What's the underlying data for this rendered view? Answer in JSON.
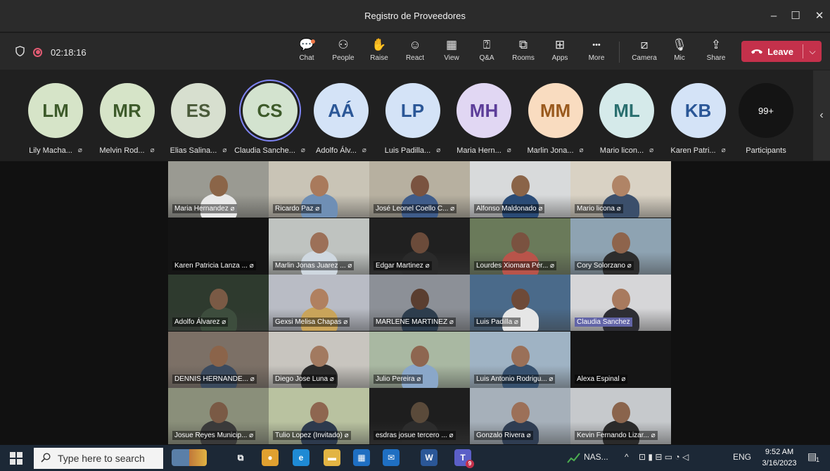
{
  "window": {
    "title": "Registro de Proveedores",
    "controls": [
      "–",
      "☐",
      "✕"
    ]
  },
  "meeting": {
    "timer": "02:18:16",
    "toolbar": [
      {
        "key": "chat",
        "label": "Chat",
        "icon": "chat-icon"
      },
      {
        "key": "people",
        "label": "People",
        "icon": "people-icon"
      },
      {
        "key": "raise",
        "label": "Raise",
        "icon": "raise-hand-icon"
      },
      {
        "key": "react",
        "label": "React",
        "icon": "smile-icon"
      },
      {
        "key": "view",
        "label": "View",
        "icon": "grid-icon"
      },
      {
        "key": "qa",
        "label": "Q&A",
        "icon": "qa-icon"
      },
      {
        "key": "rooms",
        "label": "Rooms",
        "icon": "rooms-icon"
      },
      {
        "key": "apps",
        "label": "Apps",
        "icon": "plus-square-icon"
      },
      {
        "key": "more",
        "label": "More",
        "icon": "ellipsis-icon"
      },
      {
        "key": "camera",
        "label": "Camera",
        "icon": "camera-off-icon"
      },
      {
        "key": "mic",
        "label": "Mic",
        "icon": "mic-off-icon"
      },
      {
        "key": "share",
        "label": "Share",
        "icon": "share-icon"
      }
    ],
    "leave_label": "Leave",
    "colors": {
      "leave": "#c4314b",
      "accent": "#6264a7",
      "recording": "#e25b73"
    }
  },
  "strip": {
    "participants": [
      {
        "initials": "LM",
        "name": "Lily Macha...",
        "bg": "#d6e4c8",
        "fg": "#3d5a2a"
      },
      {
        "initials": "MR",
        "name": "Melvin Rod...",
        "bg": "#d6e4c8",
        "fg": "#3d5a2a"
      },
      {
        "initials": "ES",
        "name": "Elias Salina...",
        "bg": "#d7dfcf",
        "fg": "#4a5a3a"
      },
      {
        "initials": "CS",
        "name": "Claudia Sanche...",
        "bg": "#d3e3cf",
        "fg": "#3d5a2a",
        "speaking": true
      },
      {
        "initials": "AÁ",
        "name": "Adolfo Álv...",
        "bg": "#d4e3f7",
        "fg": "#2b5797"
      },
      {
        "initials": "LP",
        "name": "Luis Padilla...",
        "bg": "#d4e3f7",
        "fg": "#2b5797"
      },
      {
        "initials": "MH",
        "name": "Maria Hern...",
        "bg": "#e1d7f3",
        "fg": "#5c3d99"
      },
      {
        "initials": "MM",
        "name": "Marlin Jona...",
        "bg": "#f9dcc0",
        "fg": "#9a5a1e"
      },
      {
        "initials": "ML",
        "name": "Mario licon...",
        "bg": "#d5eaea",
        "fg": "#2a6f6f"
      },
      {
        "initials": "KB",
        "name": "Karen Patri...",
        "bg": "#d4e3f7",
        "fg": "#2b5797"
      }
    ],
    "more_count": "99+",
    "more_label": "Participants"
  },
  "gallery": {
    "tiles": [
      {
        "name": "Maria Hernandez",
        "col": 0,
        "row": 0,
        "scene": "#9a9a92",
        "shirt": "#e9e9e9",
        "skin": "#8b6548"
      },
      {
        "name": "Ricardo Paz",
        "col": 1,
        "row": 0,
        "scene": "#c9c4b6",
        "shirt": "#6f8fb5",
        "skin": "#a97a5c"
      },
      {
        "name": "José Leonel Coello C...",
        "col": 2,
        "row": 0,
        "scene": "#b7b0a0",
        "shirt": "#3f5c8a",
        "skin": "#7a5340"
      },
      {
        "name": "Alfonso Maldonado",
        "col": 3,
        "row": 0,
        "scene": "#d8dadb",
        "shirt": "#2a4b76",
        "skin": "#8a6448"
      },
      {
        "name": "Mario licona",
        "col": 4,
        "row": 0,
        "scene": "#d9d2c4",
        "shirt": "#3b4f6b",
        "skin": "#b08466"
      },
      {
        "name": "Karen Patricia Lanza ...",
        "col": 0,
        "row": 1,
        "scene": "#141414",
        "shirt": "#141414",
        "skin": "#141414",
        "dark": true
      },
      {
        "name": "Marlin Jonas Juarez ...",
        "col": 1,
        "row": 1,
        "scene": "#bfc3c0",
        "shirt": "#cfd8e0",
        "skin": "#9c7058"
      },
      {
        "name": "Edgar Martinez",
        "col": 2,
        "row": 1,
        "scene": "#202020",
        "shirt": "#2a2a2a",
        "skin": "#6b4b3a"
      },
      {
        "name": "Lourdes Xiomara Pér...",
        "col": 3,
        "row": 1,
        "scene": "#6a7a5a",
        "shirt": "#b8544a",
        "skin": "#7a5240"
      },
      {
        "name": "Cory Solorzano",
        "col": 4,
        "row": 1,
        "scene": "#8ea3b2",
        "shirt": "#2d2d2d",
        "skin": "#8e644c"
      },
      {
        "name": "Adolfo Álvarez",
        "col": 0,
        "row": 2,
        "scene": "#2e3a2e",
        "shirt": "#3d4d3d",
        "skin": "#7a5a45"
      },
      {
        "name": "Gexsi Melisa Chapas",
        "col": 1,
        "row": 2,
        "scene": "#b9bcc5",
        "shirt": "#c9a45a",
        "skin": "#b08060"
      },
      {
        "name": "MARLENE MARTINEZ",
        "col": 2,
        "row": 2,
        "scene": "#8c9097",
        "shirt": "#2d3d4d",
        "skin": "#5a3e30"
      },
      {
        "name": "Luis Padilla",
        "col": 3,
        "row": 2,
        "scene": "#4a6a8a",
        "shirt": "#e6e6e6",
        "skin": "#6e4a38"
      },
      {
        "name": "Claudia Sanchez",
        "col": 4,
        "row": 2,
        "scene": "#d6d6d8",
        "shirt": "#2d2d33",
        "skin": "#a87a5e",
        "highlight": true
      },
      {
        "name": "DENNIS HERNANDE...",
        "col": 0,
        "row": 3,
        "scene": "#7c7066",
        "shirt": "#3b4a5e",
        "skin": "#8b644a"
      },
      {
        "name": "Diego Jose Luna",
        "col": 1,
        "row": 3,
        "scene": "#c8c5bf",
        "shirt": "#2a2a2a",
        "skin": "#a27a60"
      },
      {
        "name": "Julio Pereira",
        "col": 2,
        "row": 3,
        "scene": "#a9b8a2",
        "shirt": "#8aa7c9",
        "skin": "#8e6650"
      },
      {
        "name": "Luis Antonio Rodrigu...",
        "col": 3,
        "row": 3,
        "scene": "#9fb3c4",
        "shirt": "#36506e",
        "skin": "#9a7058"
      },
      {
        "name": "Alexa Espinal",
        "col": 4,
        "row": 3,
        "scene": "#151515",
        "shirt": "#151515",
        "skin": "#151515",
        "dark": true
      },
      {
        "name": "Josue Reyes Municip...",
        "col": 0,
        "row": 4,
        "scene": "#8a8f7a",
        "shirt": "#3a3a3a",
        "skin": "#7a5a45"
      },
      {
        "name": "Tulio Lopez (Invitado)",
        "col": 1,
        "row": 4,
        "scene": "#b9c2a0",
        "shirt": "#2d3a4d",
        "skin": "#8e6650"
      },
      {
        "name": "esdras josue tercero ...",
        "col": 2,
        "row": 4,
        "scene": "#1e1e1e",
        "shirt": "#2c2c2c",
        "skin": "#5a4a3a"
      },
      {
        "name": "Gonzalo Rivera",
        "col": 3,
        "row": 4,
        "scene": "#a6b0ba",
        "shirt": "#2f3d52",
        "skin": "#9c7058"
      },
      {
        "name": "Kevin Fernando Lizar...",
        "col": 4,
        "row": 4,
        "scene": "#c6c9cc",
        "shirt": "#2a2a2a",
        "skin": "#8a644c"
      }
    ]
  },
  "taskbar": {
    "search_placeholder": "Type here to search",
    "apps": [
      {
        "icon": "file-explorer-icon",
        "glyph": "▬",
        "bg": "#e2b443"
      },
      {
        "icon": "task-view-icon",
        "glyph": "⧉",
        "bg": "transparent"
      },
      {
        "icon": "chrome-icon",
        "glyph": "●",
        "bg": "#e0a030"
      },
      {
        "icon": "edge-icon",
        "glyph": "e",
        "bg": "#1f8ad4"
      },
      {
        "icon": "file-manager-icon",
        "glyph": "▬",
        "bg": "#e2b443"
      },
      {
        "icon": "store-icon",
        "glyph": "▦",
        "bg": "#1f6fc2"
      },
      {
        "icon": "mail-icon",
        "glyph": "✉",
        "bg": "#1f6fc2"
      },
      {
        "icon": "word-icon",
        "glyph": "W",
        "bg": "#2b5797"
      },
      {
        "icon": "teams-icon",
        "glyph": "T",
        "bg": "#5b5fc7"
      }
    ],
    "teams_badge": "9",
    "weather": "NAS...",
    "language": "ENG",
    "time": "9:52 AM",
    "date": "3/16/2023",
    "notification_count": "1"
  }
}
